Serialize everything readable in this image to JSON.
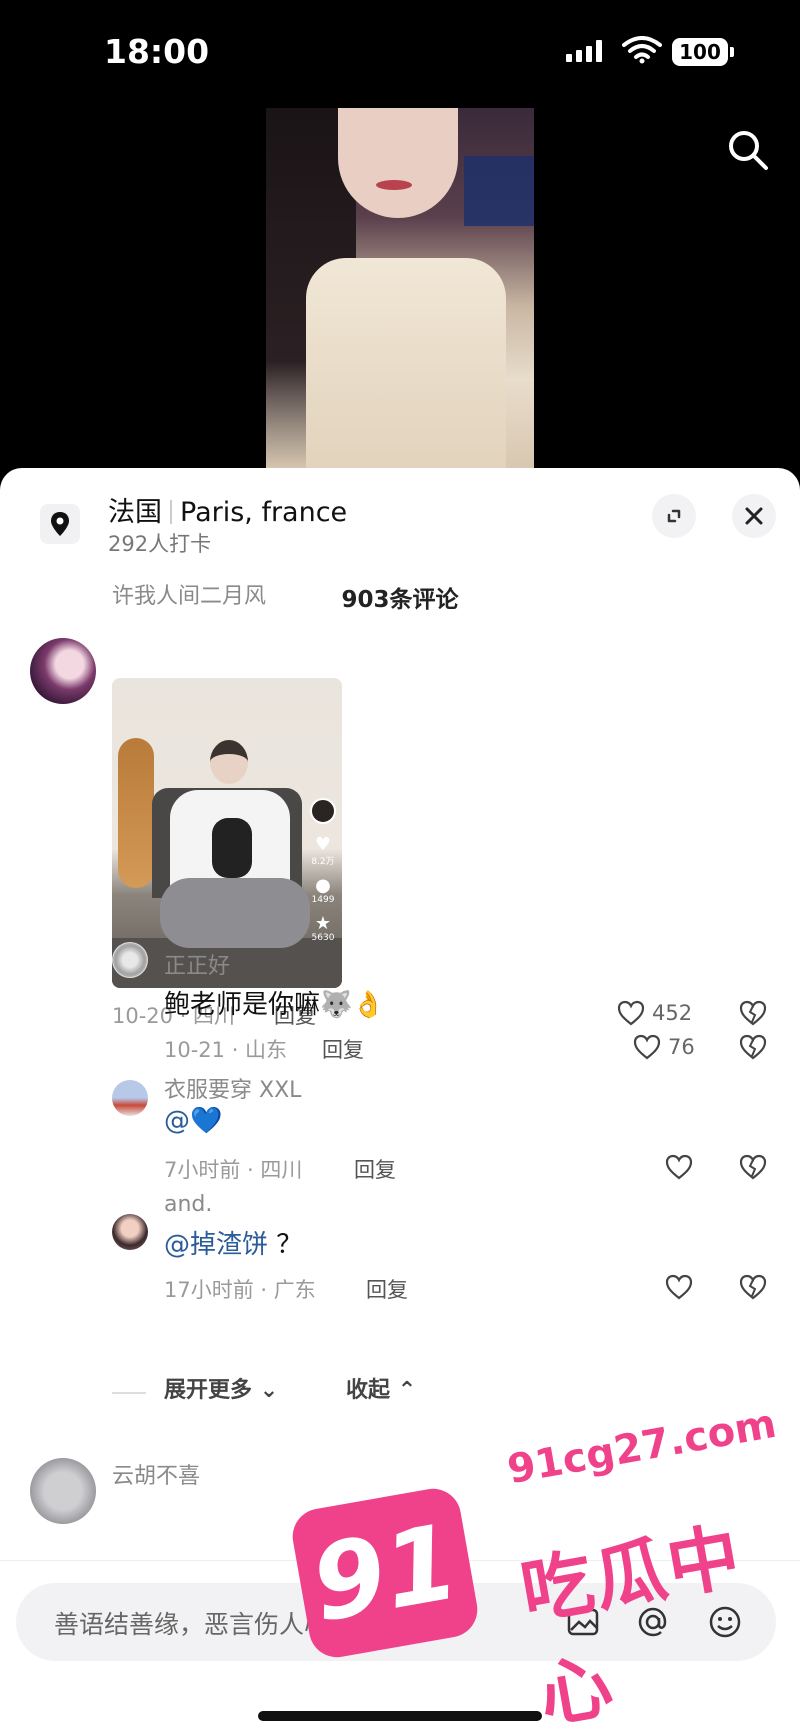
{
  "status_bar": {
    "time": "18:00",
    "battery": "100"
  },
  "location": {
    "title": "法国",
    "subtitle_en": "Paris, france",
    "checkins": "292人打卡"
  },
  "comments_header": {
    "count_label": "903条评论"
  },
  "comments": [
    {
      "user": "许我人间二月风",
      "image_stats": {
        "likes": "8.2万",
        "comments": "1499",
        "favorites": "5630"
      },
      "date_location": "10-20 · 四川",
      "reply_label": "回复",
      "likes": "452",
      "replies": [
        {
          "user": "正正好",
          "text": "鲍老师是你嘛",
          "emoji": "🐺👌",
          "date_location": "10-21 · 山东",
          "reply_label": "回复",
          "likes": "76"
        },
        {
          "user": "衣服要穿 XXL",
          "text": "@",
          "emoji": "💙",
          "date_location": "7小时前 · 四川",
          "reply_label": "回复",
          "likes": ""
        },
        {
          "user": "and.",
          "mention": "@掉渣饼",
          "text": " ？",
          "date_location": "17小时前 · 广东",
          "reply_label": "回复",
          "likes": ""
        }
      ],
      "expand_more": "展开更多",
      "collapse": "收起"
    },
    {
      "user": "云胡不喜"
    }
  ],
  "input": {
    "placeholder": "善语结善缘，恶言伤人心"
  },
  "watermark": {
    "badge": "91",
    "url": "91cg27.com",
    "title": "吃瓜中心"
  },
  "colors": {
    "accent_mention": "#2b5c9a",
    "watermark_pink": "#f0428a"
  }
}
